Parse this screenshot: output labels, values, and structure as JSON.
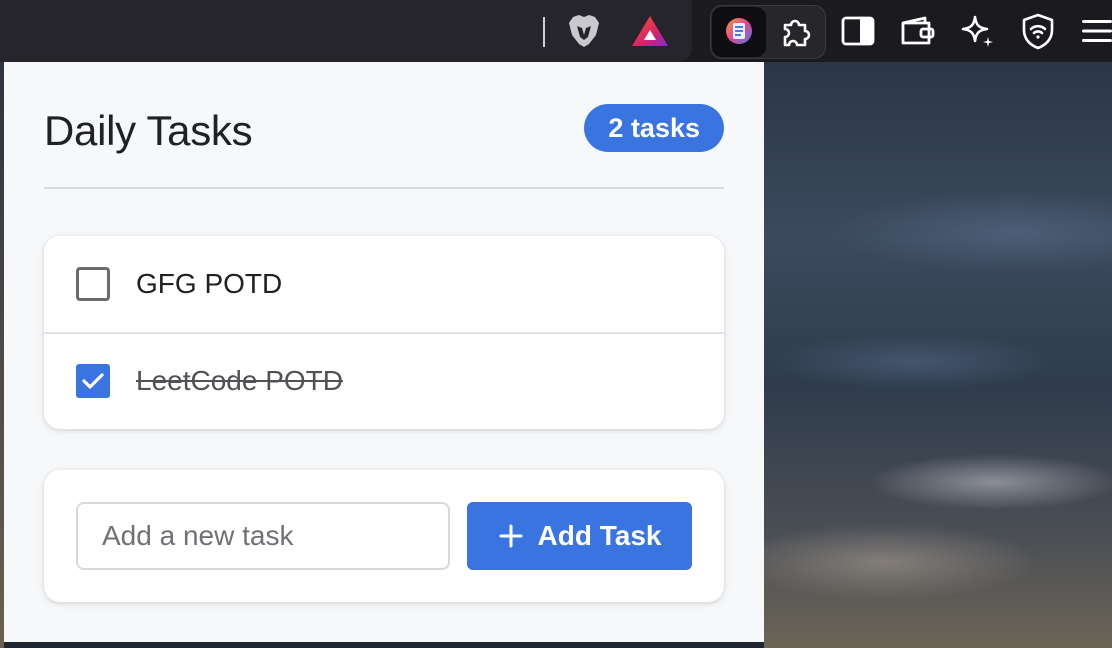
{
  "toolbar": {
    "icons": [
      "brave-lion-icon",
      "brave-rewards-triangle-icon",
      "daily-tasks-extension-icon",
      "extensions-puzzle-icon",
      "sidebar-icon",
      "wallet-icon",
      "leo-ai-sparkle-icon",
      "vpn-shield-icon",
      "menu-icon"
    ],
    "accent_colors": {
      "brave_orange": "#fb542b",
      "rewards_purple": "#7d2ad6"
    }
  },
  "popup": {
    "title": "Daily Tasks",
    "task_count_label": "2 tasks",
    "tasks": [
      {
        "label": "GFG POTD",
        "completed": false
      },
      {
        "label": "LeetCode POTD",
        "completed": true
      }
    ],
    "input": {
      "placeholder": "Add a new task",
      "value": ""
    },
    "add_button_label": "Add Task",
    "colors": {
      "primary": "#3a74e0",
      "background": "#f7f8fa",
      "card": "#ffffff"
    }
  }
}
